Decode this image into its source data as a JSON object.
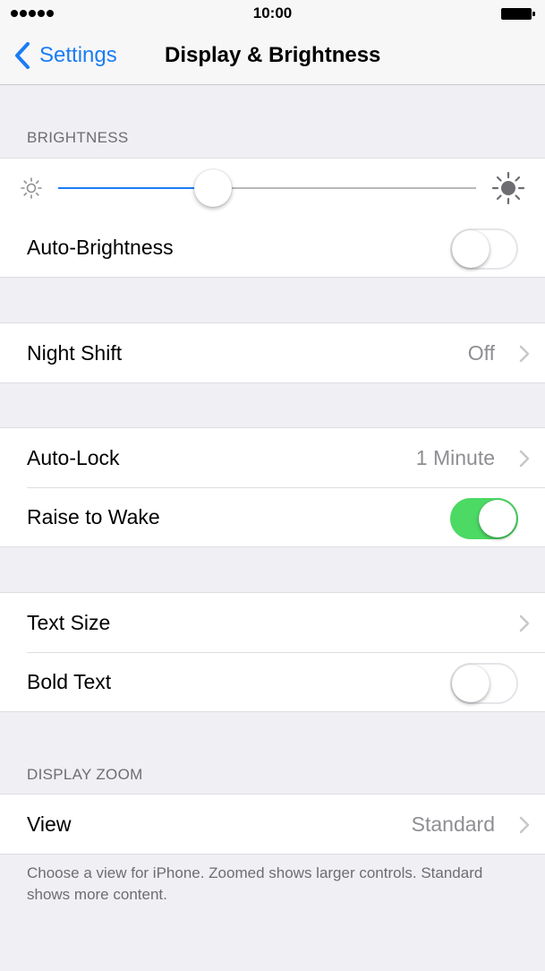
{
  "status_bar": {
    "time": "10:00"
  },
  "nav": {
    "back_label": "Settings",
    "title": "Display & Brightness"
  },
  "brightness": {
    "header": "BRIGHTNESS",
    "level": 0.37,
    "auto_brightness": {
      "label": "Auto-Brightness",
      "on": false
    }
  },
  "night_shift": {
    "label": "Night Shift",
    "value": "Off"
  },
  "auto_lock": {
    "label": "Auto-Lock",
    "value": "1 Minute"
  },
  "raise_to_wake": {
    "label": "Raise to Wake",
    "on": true
  },
  "text_size": {
    "label": "Text Size"
  },
  "bold_text": {
    "label": "Bold Text",
    "on": false
  },
  "display_zoom": {
    "header": "DISPLAY ZOOM",
    "view": {
      "label": "View",
      "value": "Standard"
    },
    "footer": "Choose a view for iPhone. Zoomed shows larger controls. Standard shows more content."
  },
  "colors": {
    "accent": "#1a7cf5",
    "toggle_on": "#4cd964",
    "background": "#efeff4"
  }
}
